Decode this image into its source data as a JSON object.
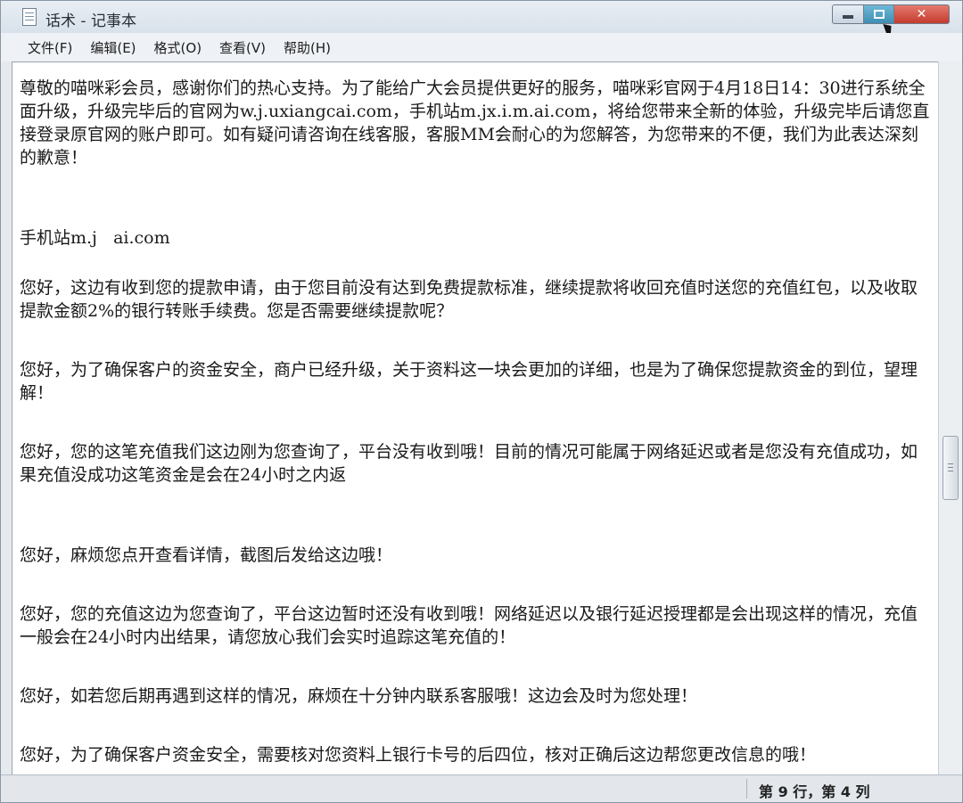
{
  "window": {
    "title": "话术 - 记事本"
  },
  "menu": {
    "items": [
      {
        "label": "文件(F)"
      },
      {
        "label": "编辑(E)"
      },
      {
        "label": "格式(O)"
      },
      {
        "label": "查看(V)"
      },
      {
        "label": "帮助(H)"
      }
    ]
  },
  "document": {
    "paragraphs": [
      "尊敬的喵咪彩会员，感谢你们的热心支持。为了能给广大会员提供更好的服务，喵咪彩官网于4月18日14：30进行系统全面升级，升级完毕后的官网为w.j.uxiangcai.com，手机站m.jx.i.m.ai.com，将给您带来全新的体验，升级完毕后请您直接登录原官网的账户即可。如有疑问请咨询在线客服，客服MM会耐心的为您解答，为您带来的不便，我们为此表达深刻的歉意！",
      "手机站m.j   ai.com",
      "您好，这边有收到您的提款申请，由于您目前没有达到免费提款标准，继续提款将收回充值时送您的充值红包，以及收取提款金额2%的银行转账手续费。您是否需要继续提款呢？",
      "您好，为了确保客户的资金安全，商户已经升级，关于资料这一块会更加的详细，也是为了确保您提款资金的到位，望理解！",
      "您好，您的这笔充值我们这边刚为您查询了，平台没有收到哦！目前的情况可能属于网络延迟或者是您没有充值成功，如果充值没成功这笔资金是会在24小时之内返",
      "您好，麻烦您点开查看详情，截图后发给这边哦！",
      "您好，您的充值这边为您查询了，平台这边暂时还没有收到哦！网络延迟以及银行延迟授理都是会出现这样的情况，充值一般会在24小时内出结果，请您放心我们会实时追踪这笔充值的！",
      "您好，如若您后期再遇到这样的情况，麻烦在十分钟内联系客服哦！这边会及时为您处理！",
      "您好，为了确保客户资金安全，需要核对您资料上银行卡号的后四位，核对正确后这边帮您更改信息的哦！"
    ]
  },
  "status": {
    "position": "第 9 行，第 4 列"
  },
  "colors": {
    "close_button": "#c43b2d",
    "maximize_button": "#3d8fb4"
  }
}
